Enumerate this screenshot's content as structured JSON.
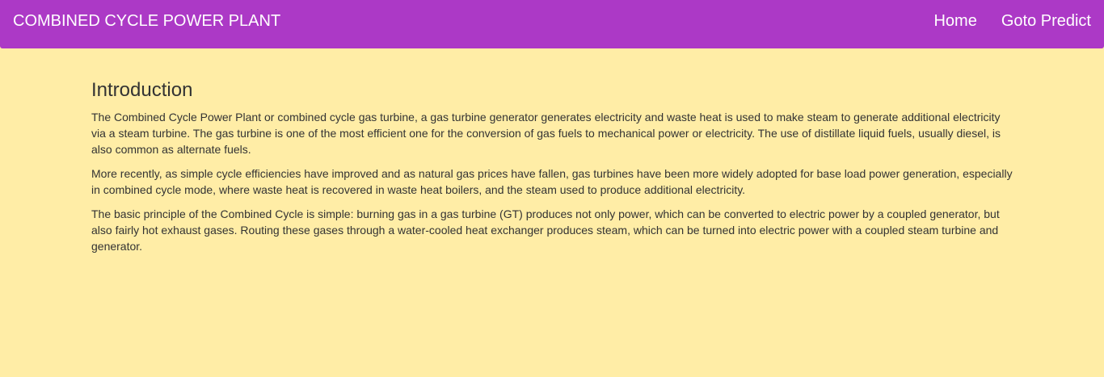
{
  "navbar": {
    "brand": "COMBINED CYCLE POWER PLANT",
    "links": [
      {
        "label": "Home"
      },
      {
        "label": "Goto Predict"
      }
    ]
  },
  "main": {
    "title": "Introduction",
    "paragraphs": [
      "The Combined Cycle Power Plant or combined cycle gas turbine, a gas turbine generator generates electricity and waste heat is used to make steam to generate additional electricity via a steam turbine. The gas turbine is one of the most efficient one for the conversion of gas fuels to mechanical power or electricity. The use of distillate liquid fuels, usually diesel, is also common as alternate fuels.",
      "More recently, as simple cycle efficiencies have improved and as natural gas prices have fallen, gas turbines have been more widely adopted for base load power generation, especially in combined cycle mode, where waste heat is recovered in waste heat boilers, and the steam used to produce additional electricity.",
      "The basic principle of the Combined Cycle is simple: burning gas in a gas turbine (GT) produces not only power, which can be converted to electric power by a coupled generator, but also fairly hot exhaust gases. Routing these gases through a water-cooled heat exchanger produces steam, which can be turned into electric power with a coupled steam turbine and generator."
    ]
  },
  "colors": {
    "navbar_bg": "#ac39c6",
    "page_bg": "#ffeda6",
    "text": "#333333"
  }
}
